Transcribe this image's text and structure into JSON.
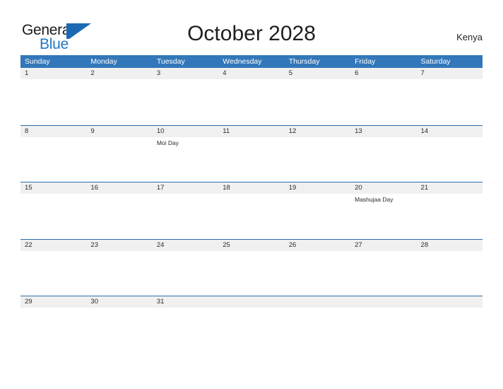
{
  "brand": {
    "name_part1": "General",
    "name_part2": "Blue",
    "flag_icon": "flag-triangle-icon",
    "accent_color": "#2077c4"
  },
  "header": {
    "title": "October 2028",
    "country": "Kenya"
  },
  "theme": {
    "header_blue": "#3277b9",
    "rule_blue": "#2a6cab",
    "band_gray": "#f0f0f0",
    "text_dark": "#2b2b2b"
  },
  "calendar": {
    "month": "October",
    "year": "2028",
    "weekdays": [
      "Sunday",
      "Monday",
      "Tuesday",
      "Wednesday",
      "Thursday",
      "Friday",
      "Saturday"
    ],
    "weeks": [
      {
        "days": [
          {
            "num": "1",
            "events": []
          },
          {
            "num": "2",
            "events": []
          },
          {
            "num": "3",
            "events": []
          },
          {
            "num": "4",
            "events": []
          },
          {
            "num": "5",
            "events": []
          },
          {
            "num": "6",
            "events": []
          },
          {
            "num": "7",
            "events": []
          }
        ]
      },
      {
        "days": [
          {
            "num": "8",
            "events": []
          },
          {
            "num": "9",
            "events": []
          },
          {
            "num": "10",
            "events": [
              "Moi Day"
            ]
          },
          {
            "num": "11",
            "events": []
          },
          {
            "num": "12",
            "events": []
          },
          {
            "num": "13",
            "events": []
          },
          {
            "num": "14",
            "events": []
          }
        ]
      },
      {
        "days": [
          {
            "num": "15",
            "events": []
          },
          {
            "num": "16",
            "events": []
          },
          {
            "num": "17",
            "events": []
          },
          {
            "num": "18",
            "events": []
          },
          {
            "num": "19",
            "events": []
          },
          {
            "num": "20",
            "events": [
              "Mashujaa Day"
            ]
          },
          {
            "num": "21",
            "events": []
          }
        ]
      },
      {
        "days": [
          {
            "num": "22",
            "events": []
          },
          {
            "num": "23",
            "events": []
          },
          {
            "num": "24",
            "events": []
          },
          {
            "num": "25",
            "events": []
          },
          {
            "num": "26",
            "events": []
          },
          {
            "num": "27",
            "events": []
          },
          {
            "num": "28",
            "events": []
          }
        ]
      },
      {
        "days": [
          {
            "num": "29",
            "events": []
          },
          {
            "num": "30",
            "events": []
          },
          {
            "num": "31",
            "events": []
          },
          {
            "num": "",
            "events": []
          },
          {
            "num": "",
            "events": []
          },
          {
            "num": "",
            "events": []
          },
          {
            "num": "",
            "events": []
          }
        ]
      }
    ]
  }
}
